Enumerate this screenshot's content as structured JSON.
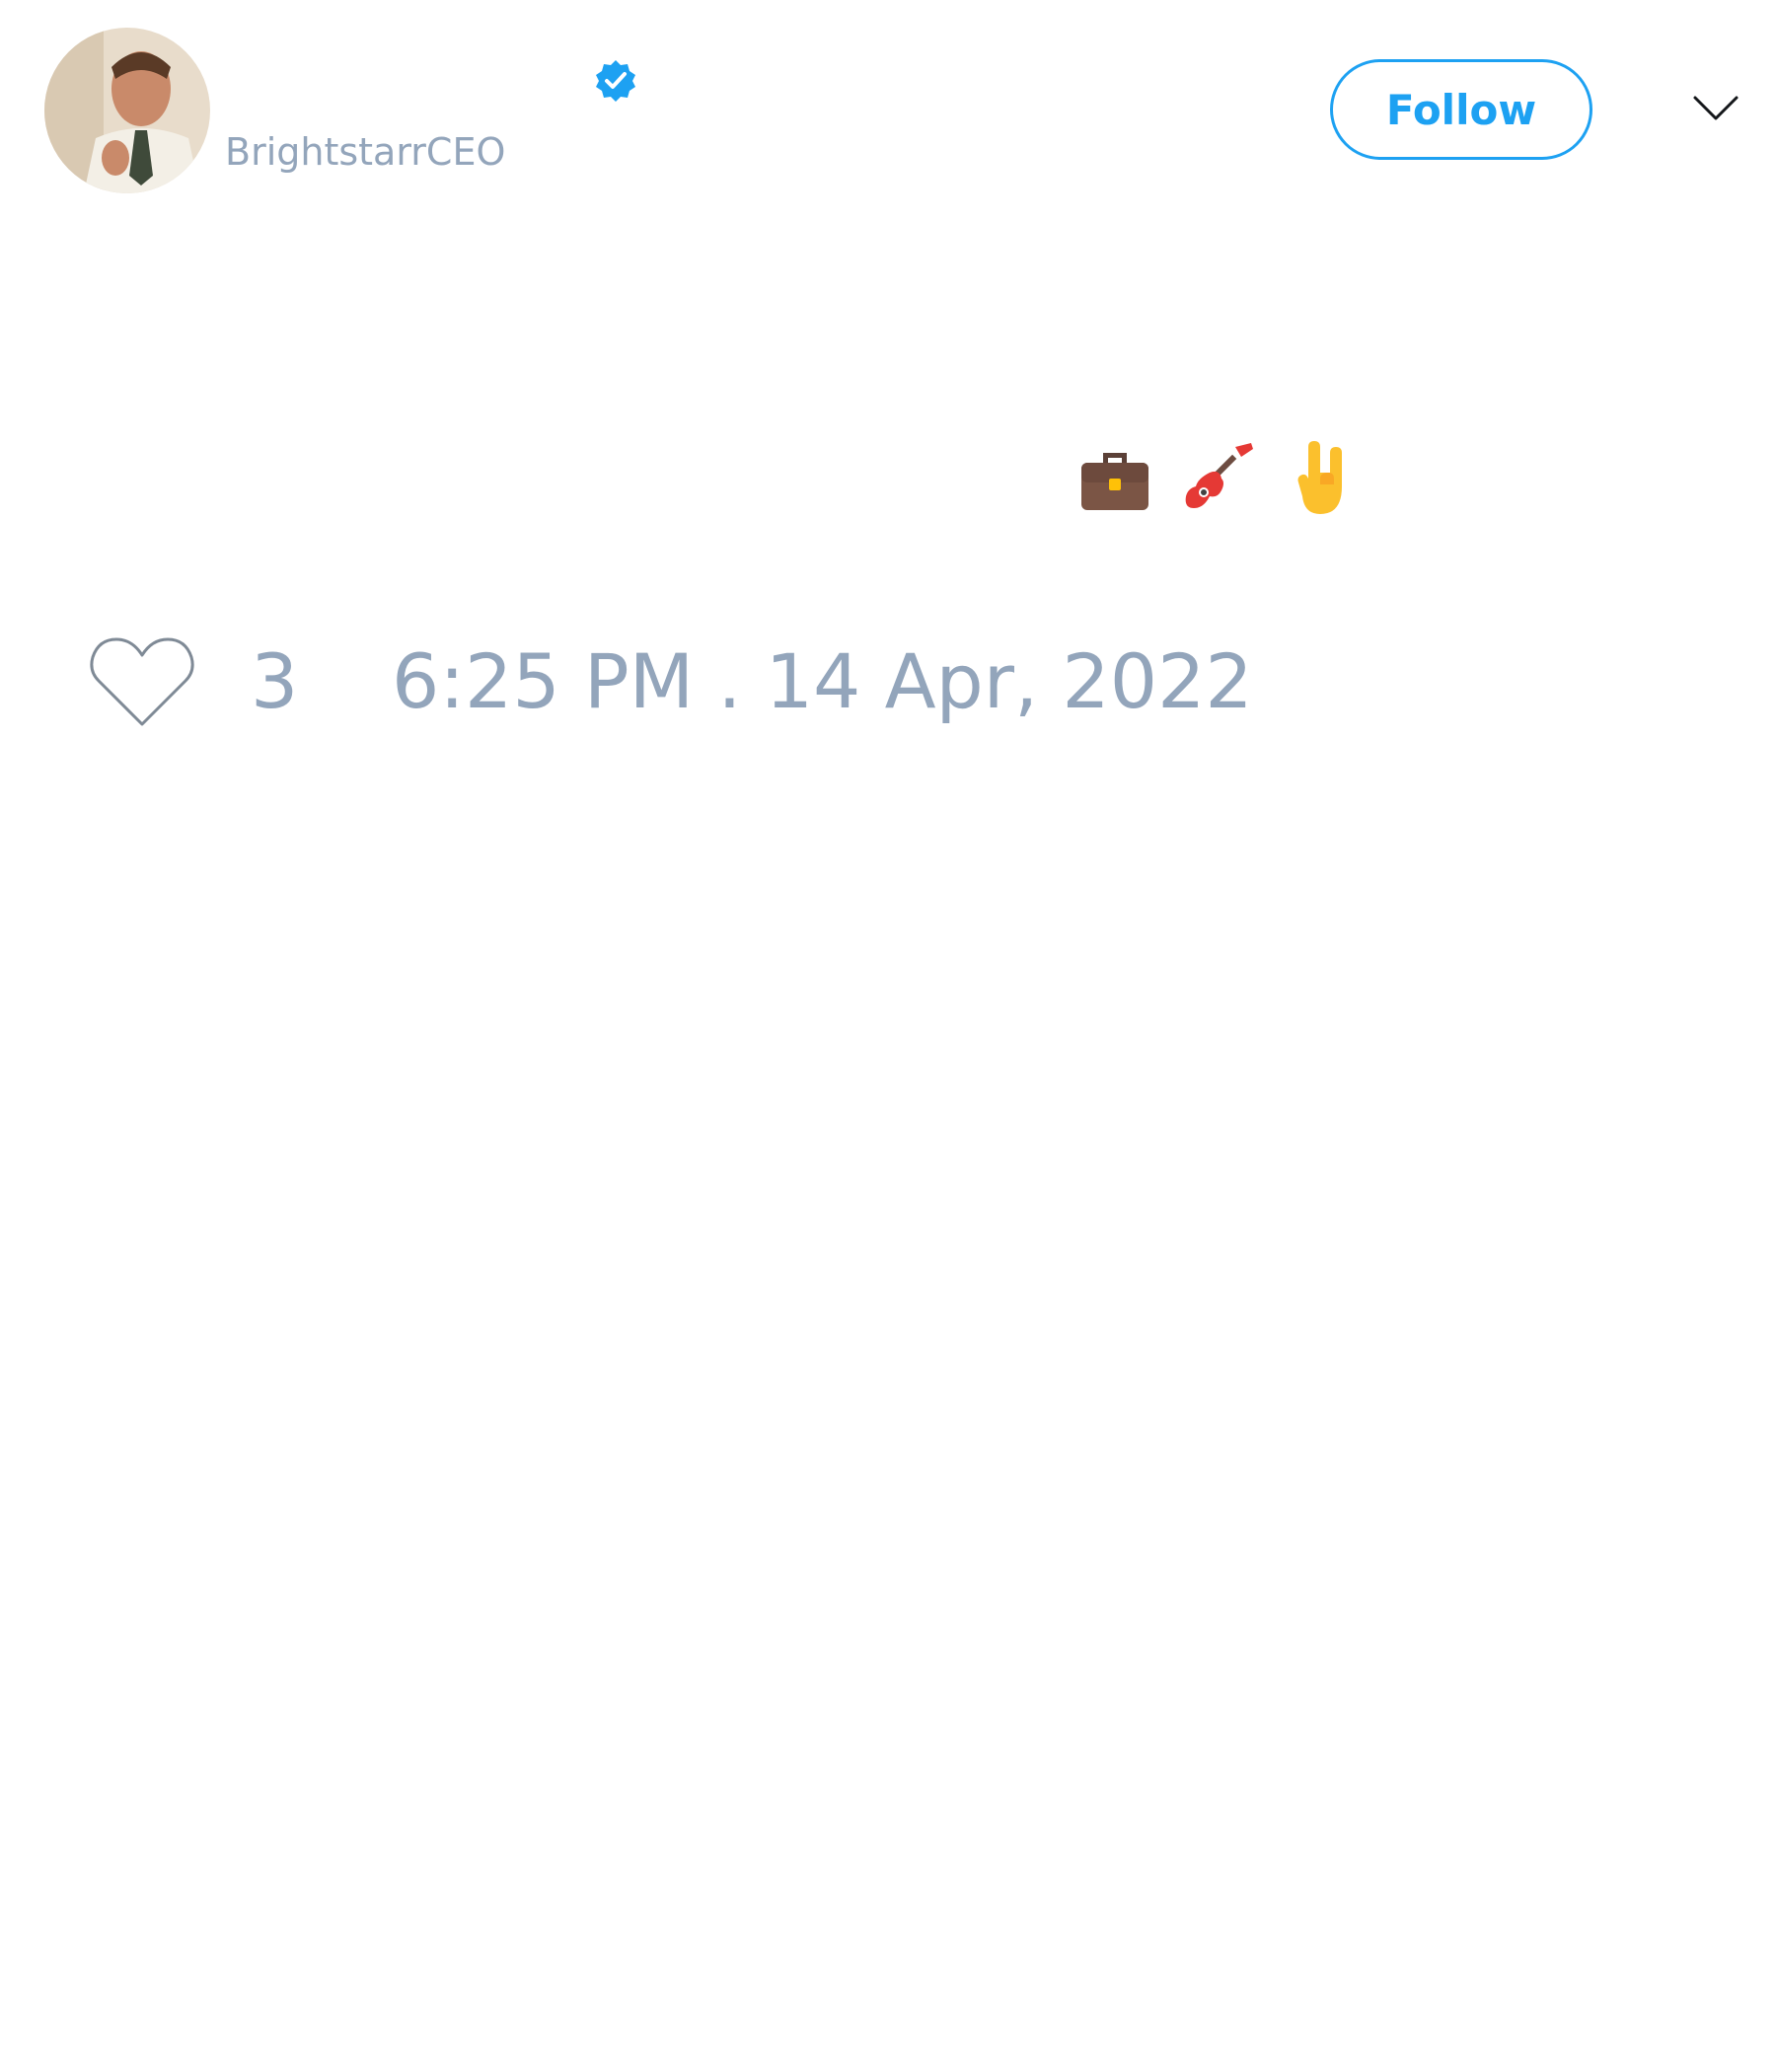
{
  "author": {
    "display_name": "",
    "handle": "BrightstarrCEO",
    "verified": true,
    "avatar_icon": "profile-photo"
  },
  "header": {
    "follow_label": "Follow",
    "more_icon": "chevron-down-icon"
  },
  "tweet": {
    "text": "",
    "emojis": [
      "briefcase",
      "guitar",
      "sign-of-the-horns"
    ]
  },
  "footer": {
    "like_icon": "heart-outline-icon",
    "like_count": "3",
    "timestamp": "6:25 PM . 14 Apr, 2022"
  },
  "colors": {
    "accent": "#1da1f2",
    "muted_text": "#93a5bb",
    "background": "#ffffff"
  }
}
